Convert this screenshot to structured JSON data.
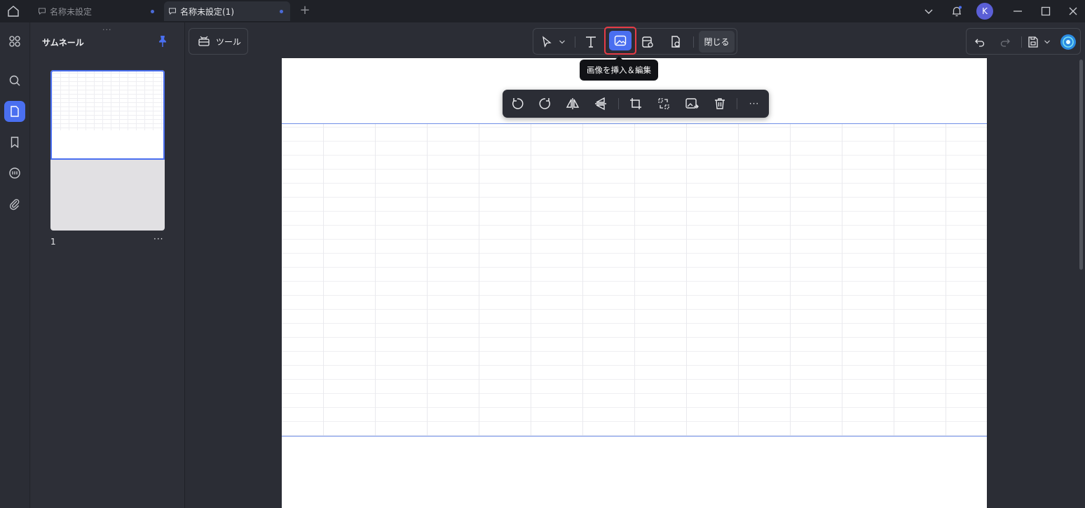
{
  "tabs": [
    {
      "label": "名称未設定"
    },
    {
      "label": "名称未設定(1)"
    }
  ],
  "avatar": {
    "initial": "K"
  },
  "panel": {
    "title": "サムネール",
    "thumbnail": {
      "page_number": "1",
      "more": "···"
    }
  },
  "toolbar": {
    "tools_label": "ツール",
    "close_label": "閉じる"
  },
  "tooltip": {
    "text": "画像を挿入＆編集"
  },
  "image_toolbar": {
    "more": "···"
  },
  "colors": {
    "accent": "#4a6ff0",
    "highlight": "#e63b45",
    "background": "#2b2d35"
  }
}
